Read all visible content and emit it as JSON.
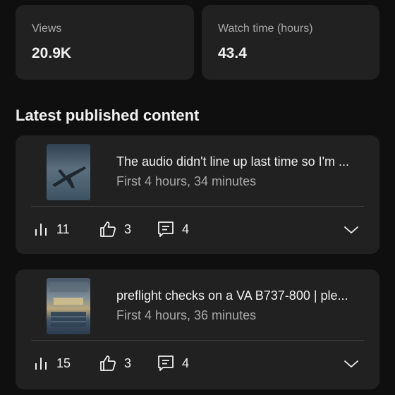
{
  "stats": {
    "views": {
      "label": "Views",
      "value": "20.9K"
    },
    "watch_time": {
      "label": "Watch time (hours)",
      "value": "43.4"
    }
  },
  "section_title": "Latest published content",
  "videos": [
    {
      "title": "The audio didn't line up last time so I'm ...",
      "subtitle": "First 4 hours, 34 minutes",
      "views": "11",
      "likes": "3",
      "comments": "4"
    },
    {
      "title": "preflight checks on a VA B737-800 | ple...",
      "subtitle": "First 4 hours, 36 minutes",
      "views": "15",
      "likes": "3",
      "comments": "4"
    }
  ],
  "icons": {
    "views": "bar-chart-icon",
    "likes": "thumbs-up-icon",
    "comments": "comment-icon",
    "expand": "chevron-down-icon"
  }
}
